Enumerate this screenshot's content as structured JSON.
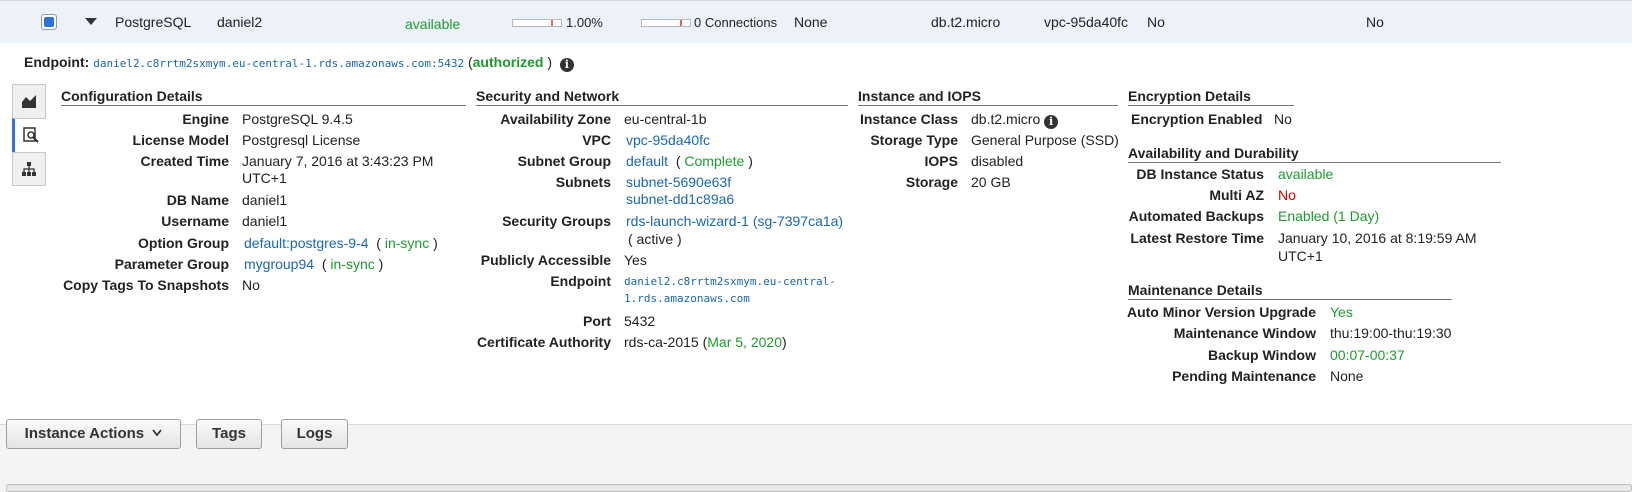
{
  "row": {
    "engine": "PostgreSQL",
    "db_identifier": "daniel2",
    "status": "available",
    "cpu": "1.00%",
    "connections": "0 Connections",
    "replication_role": "None",
    "instance_class": "db.t2.micro",
    "vpc": "vpc-95da40fc",
    "multi_az": "No",
    "replication": "No",
    "cpu_fraction": 0.01,
    "connections_fraction": 0.0
  },
  "endpoint": {
    "label": "Endpoint:",
    "value": "daniel2.c8rrtm2sxmym.eu-central-1.rds.amazonaws.com:5432",
    "paren_open": "(",
    "status": "authorized",
    "paren_close": ")"
  },
  "sidetabs": [
    "monitoring-icon",
    "details-icon",
    "hierarchy-icon"
  ],
  "configuration": {
    "title": "Configuration Details",
    "engine_label": "Engine",
    "engine": "PostgreSQL 9.4.5",
    "license_label": "License Model",
    "license": "Postgresql License",
    "created_label": "Created Time",
    "created_line1": "January 7, 2016 at 3:43:23 PM",
    "created_line2": "UTC+1",
    "dbname_label": "DB Name",
    "dbname": "daniel1",
    "username_label": "Username",
    "username": "daniel1",
    "option_group_label": "Option Group",
    "option_group": "default:postgres-9-4",
    "option_group_status": "in-sync",
    "parameter_group_label": "Parameter Group",
    "parameter_group": "mygroup94",
    "parameter_group_status": "in-sync",
    "copy_tags_label": "Copy Tags To Snapshots",
    "copy_tags": "No"
  },
  "security": {
    "title": "Security and Network",
    "az_label": "Availability Zone",
    "az": "eu-central-1b",
    "vpc_label": "VPC",
    "vpc": "vpc-95da40fc",
    "subnet_group_label": "Subnet Group",
    "subnet_group": "default",
    "subnet_group_status": "Complete",
    "subnets_label": "Subnets",
    "subnet1": "subnet-5690e63f",
    "subnet2": "subnet-dd1c89a6",
    "sg_label": "Security Groups",
    "sg": "rds-launch-wizard-1 (sg-7397ca1a)",
    "sg_status": "( active )",
    "public_label": "Publicly Accessible",
    "public": "Yes",
    "endpoint_label": "Endpoint",
    "endpoint_line1": "daniel2.c8rrtm2sxmym.eu-central-",
    "endpoint_line2": "1.rds.amazonaws.com",
    "port_label": "Port",
    "port": "5432",
    "ca_label": "Certificate Authority",
    "ca": "rds-ca-2015",
    "ca_date": "Mar 5, 2020"
  },
  "instance": {
    "title": "Instance and IOPS",
    "class_label": "Instance Class",
    "class": "db.t2.micro",
    "storage_type_label": "Storage Type",
    "storage_type": "General Purpose (SSD)",
    "iops_label": "IOPS",
    "iops": "disabled",
    "storage_label": "Storage",
    "storage": "20 GB"
  },
  "encryption": {
    "title": "Encryption Details",
    "enabled_label": "Encryption Enabled",
    "enabled": "No"
  },
  "availability": {
    "title": "Availability and Durability",
    "status_label": "DB Instance Status",
    "status": "available",
    "multiaz_label": "Multi AZ",
    "multiaz": "No",
    "backups_label": "Automated Backups",
    "backups": "Enabled (1 Day)",
    "restore_label": "Latest Restore Time",
    "restore_line1": "January 10, 2016 at 8:19:59 AM",
    "restore_line2": "UTC+1"
  },
  "maintenance": {
    "title": "Maintenance Details",
    "auto_minor_label": "Auto Minor Version Upgrade",
    "auto_minor": "Yes",
    "window_label": "Maintenance Window",
    "window": "thu:19:00-thu:19:30",
    "backup_window_label": "Backup Window",
    "backup_window": "00:07-00:37",
    "pending_label": "Pending Maintenance",
    "pending": "None"
  },
  "buttons": {
    "instance_actions": "Instance Actions",
    "tags": "Tags",
    "logs": "Logs"
  },
  "colors": {
    "green": "#1e9b2f",
    "red": "#d40000",
    "link": "#1a66b3",
    "accent": "#2f73d8"
  }
}
